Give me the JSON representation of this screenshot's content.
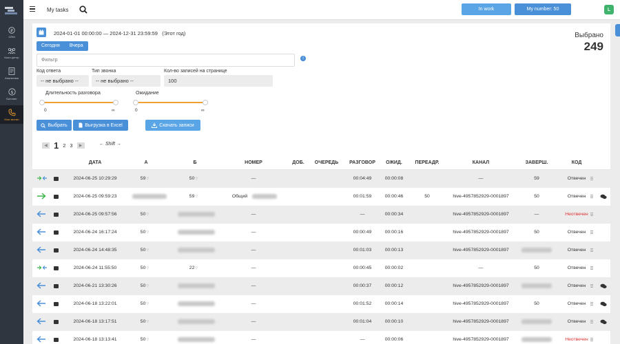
{
  "sidebar": {
    "items": [
      {
        "label": "CRM",
        "icon": "ruble-icon"
      },
      {
        "label": "Колл-центр",
        "icon": "people-icon"
      },
      {
        "label": "Аналитика",
        "icon": "report-icon"
      },
      {
        "label": "Биллинг",
        "icon": "billing-icon"
      },
      {
        "label": "Мои звонки",
        "icon": "phone-icon",
        "active": true
      }
    ]
  },
  "header": {
    "tasks_label": "My tasks",
    "in_work_label": "In work",
    "my_number_label": "My number: 50",
    "profile_initial": "L"
  },
  "filters": {
    "period_text": "2024-01-01 00:00:00 — 2024-12-31 23:59:59",
    "period_hint": "(Этот год)",
    "today_label": "Сегодня",
    "yesterday_label": "Вчера",
    "selected_label": "Выбрано",
    "selected_count": "249",
    "filter_placeholder": "Фильтр",
    "answer_code_label": "Код ответа",
    "answer_code_value": "-- не выбрано --",
    "call_type_label": "Тип звонка",
    "call_type_value": "-- не выбрано --",
    "per_page_label": "Кол-во записей на странице",
    "per_page_value": "100",
    "duration_label": "Длительность разговора",
    "duration_min": "0",
    "duration_max": "∞",
    "wait_label": "Ожидание",
    "wait_min": "0",
    "wait_max": "∞",
    "select_btn": "Выбрать",
    "excel_btn": "Выгрузка в Excel",
    "download_btn": "Скачать записи"
  },
  "pager": {
    "pages": [
      "1",
      "2",
      "3"
    ],
    "shift_label": "Shift"
  },
  "table": {
    "headers": {
      "date": "ДАТА",
      "a": "А",
      "b": "Б",
      "number": "НОМЕР",
      "ext": "ДОБ.",
      "queue": "ОЧЕРЕДЬ",
      "talk": "РАЗГОВОР",
      "wait": "ОЖИД.",
      "redirect": "ПЕРЕАДР.",
      "channel": "КАНАЛ",
      "finished": "ЗАВЕРШ.",
      "code": "КОД"
    },
    "rows": [
      {
        "dir": "transfer",
        "date": "2024-06-25 10:29:29",
        "a": "59",
        "b": "50",
        "number": "—",
        "talk": "00:04:49",
        "wait": "00:00:08",
        "redirect": "",
        "channel": "—",
        "finished": "59",
        "code": "Отвечен",
        "chat": false
      },
      {
        "dir": "out",
        "date": "2024-06-25 09:59:23",
        "a": "",
        "b": "59",
        "number": "Общий",
        "talk": "00:01:59",
        "wait": "00:00:46",
        "redirect": "50",
        "channel": "hive-4957852929-0001897",
        "finished": "50",
        "code": "Отвечен",
        "chat": true
      },
      {
        "dir": "in",
        "date": "2024-06-25 09:57:56",
        "a": "50",
        "b": "",
        "number": "—",
        "talk": "—",
        "wait": "00:00:34",
        "redirect": "",
        "channel": "hive-4957852929-0001897",
        "finished": "—",
        "code": "Неотвечен",
        "chat": false
      },
      {
        "dir": "in",
        "date": "2024-06-24 16:17:24",
        "a": "50",
        "b": "",
        "number": "—",
        "talk": "00:00:49",
        "wait": "00:00:16",
        "redirect": "",
        "channel": "hive-4957852929-0001897",
        "finished": "50",
        "code": "Отвечен",
        "chat": false
      },
      {
        "dir": "in",
        "date": "2024-06-24 14:48:35",
        "a": "50",
        "b": "",
        "number": "—",
        "talk": "00:01:03",
        "wait": "00:00:13",
        "redirect": "",
        "channel": "hive-4957852929-0001897",
        "finished": "",
        "code": "Отвечен",
        "chat": false
      },
      {
        "dir": "transfer",
        "date": "2024-06-24 11:55:50",
        "a": "50",
        "b": "22",
        "number": "—",
        "talk": "00:00:45",
        "wait": "00:00:02",
        "redirect": "",
        "channel": "—",
        "finished": "50",
        "code": "Отвечен",
        "chat": false
      },
      {
        "dir": "in",
        "date": "2024-06-21 13:30:26",
        "a": "50",
        "b": "",
        "number": "—",
        "talk": "00:00:37",
        "wait": "00:00:12",
        "redirect": "",
        "channel": "hive-4957852929-0001897",
        "finished": "",
        "code": "Отвечен",
        "chat": true
      },
      {
        "dir": "in",
        "date": "2024-06-18 13:22:01",
        "a": "50",
        "b": "",
        "number": "—",
        "talk": "00:01:52",
        "wait": "00:00:14",
        "redirect": "",
        "channel": "hive-4957852929-0001897",
        "finished": "50",
        "code": "Отвечен",
        "chat": true
      },
      {
        "dir": "in",
        "date": "2024-06-18 13:17:51",
        "a": "50",
        "b": "",
        "number": "—",
        "talk": "00:01:04",
        "wait": "00:00:10",
        "redirect": "",
        "channel": "hive-4957852929-0001897",
        "finished": "",
        "code": "Отвечен",
        "chat": true
      },
      {
        "dir": "in",
        "date": "2024-06-18 13:13:41",
        "a": "50",
        "b": "",
        "number": "—",
        "talk": "—",
        "wait": "00:00:06",
        "redirect": "",
        "channel": "hive-4957852929-0001897",
        "finished": "",
        "code": "Неотвечен",
        "chat": false
      }
    ]
  },
  "colors": {
    "accent": "#4a90d9",
    "slider": "#f0a030",
    "missed": "#e03030",
    "out_arrow": "#3cb54a"
  }
}
